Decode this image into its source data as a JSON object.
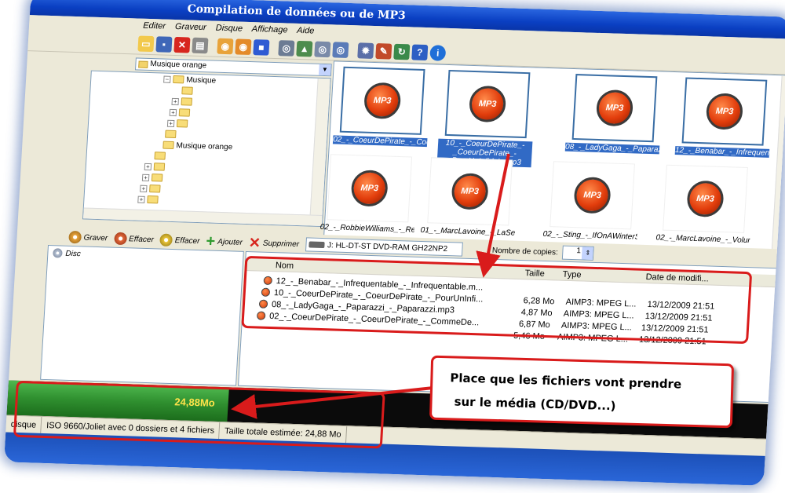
{
  "window": {
    "title": "Compilation de données ou de MP3",
    "menu": [
      "Editer",
      "Graveur",
      "Disque",
      "Affichage",
      "Aide"
    ]
  },
  "tree": {
    "combo_value": "Musique orange",
    "root_label": "Musique",
    "selected_label": "Musique orange"
  },
  "thumbnails": [
    {
      "caption": "02_-_CoeurDePirate_-_Coe...",
      "selected": true
    },
    {
      "caption": "10_-_CoeurDePirate_-_CoeurDePirate_-_PourUnInfidele.mp3",
      "selected": true
    },
    {
      "caption": "08_-_LadyGaga_-_Paparaz...",
      "selected": true
    },
    {
      "caption": "12_-_Benabar_-_Infrequent...",
      "selected": true
    },
    {
      "caption": "02_-_RobbieWilliams_-_Real...",
      "selected": false
    },
    {
      "caption": "01_-_MarcLavoine_-_LaSe...",
      "selected": false
    },
    {
      "caption": "02_-_Sting_-_IfOnAWinterS...",
      "selected": false
    },
    {
      "caption": "02_-_MarcLavoine_-_Volum...",
      "selected": false
    }
  ],
  "toolbar2": {
    "graver": "Graver",
    "effacer1": "Effacer",
    "effacer2": "Effacer",
    "ajouter": "Ajouter",
    "supprimer": "Supprimer",
    "drive": "J: HL-DT-ST DVD-RAM GH22NP2",
    "copies_label": "Nombre de copies:",
    "copies_value": "1"
  },
  "disc_panel": {
    "label": "Disc"
  },
  "file_list": {
    "columns": [
      "Nom",
      "Taille",
      "Type",
      "Date de modifi..."
    ],
    "rows": [
      {
        "name": "12_-_Benabar_-_Infrequentable_-_Infrequentable.m...",
        "size": "6,28 Mo",
        "type": "AIMP3: MPEG L...",
        "date": "13/12/2009 21:51"
      },
      {
        "name": "10_-_CoeurDePirate_-_CoeurDePirate_-_PourUnInfi...",
        "size": "4,87 Mo",
        "type": "AIMP3: MPEG L...",
        "date": "13/12/2009 21:51"
      },
      {
        "name": "08_-_LadyGaga_-_Paparazzi_-_Paparazzi.mp3",
        "size": "6,87 Mo",
        "type": "AIMP3: MPEG L...",
        "date": "13/12/2009 21:51"
      },
      {
        "name": "02_-_CoeurDePirate_-_CoeurDePirate_-_CommeDe...",
        "size": "5,46 Mo",
        "type": "AIMP3: MPEG L...",
        "date": "13/12/2009 21:51"
      }
    ]
  },
  "progress": {
    "value_text": "24,88Mo",
    "fraction": 0.29
  },
  "status": {
    "cell1": "disque",
    "cell2": "ISO 9660/Joliet avec 0 dossiers et 4 fichiers",
    "cell3": "Taille totale estimée: 24,88 Mo"
  },
  "callout": {
    "line1": "Place que les fichiers vont prendre",
    "line2": "sur le média (CD/DVD...)"
  },
  "colors": {
    "annotation_red": "#d91b1b",
    "progress_green": "#2f8f2f",
    "title_blue": "#0a3fc2",
    "selection_blue": "#316ac5"
  }
}
